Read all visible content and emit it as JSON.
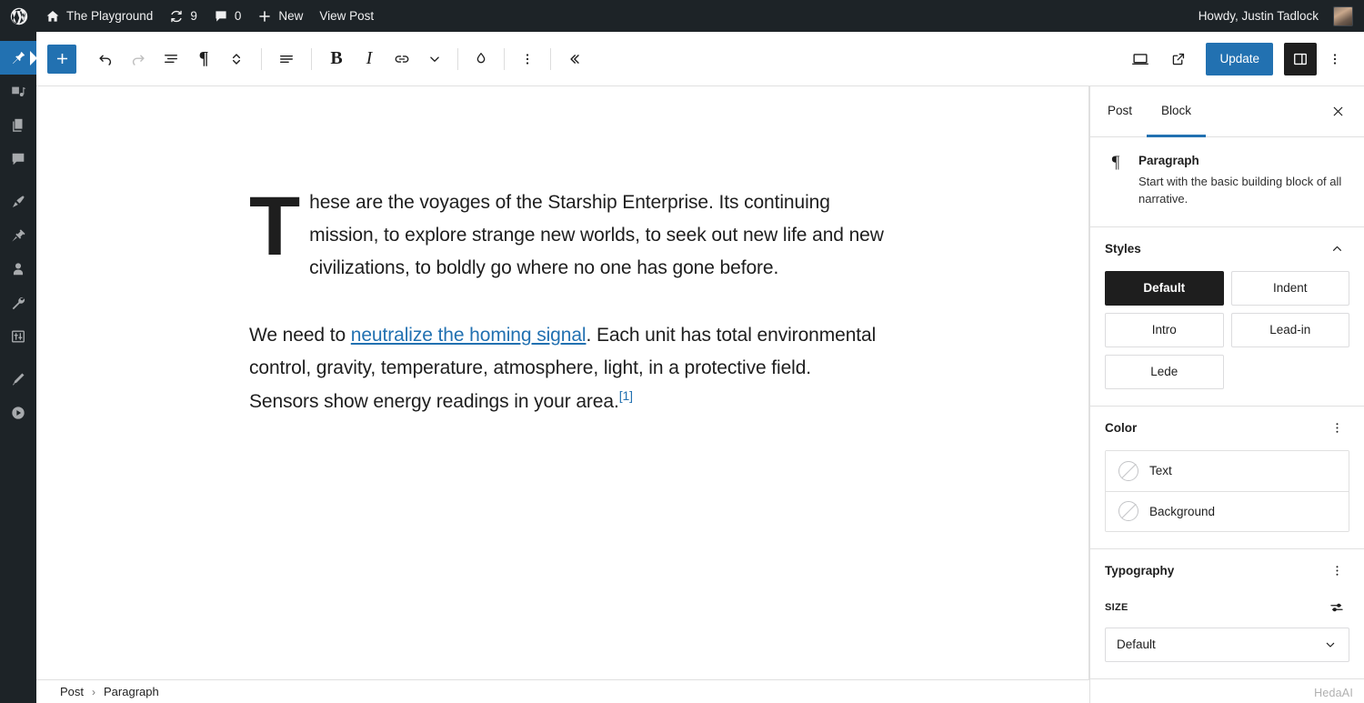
{
  "admin_bar": {
    "logo_icon": "wordpress-logo-icon",
    "site": {
      "label": "The Playground",
      "icon": "home-icon"
    },
    "updates": {
      "count": "9",
      "icon": "updates-icon"
    },
    "comments": {
      "count": "0",
      "icon": "comment-bubble-icon"
    },
    "new": {
      "label": "New",
      "icon": "plus-icon"
    },
    "view_post": {
      "label": "View Post"
    },
    "account": {
      "greeting": "Howdy, Justin Tadlock",
      "avatar": "user-avatar"
    }
  },
  "admin_menu": {
    "items": [
      {
        "name": "posts",
        "icon": "pin-icon",
        "current": true
      },
      {
        "name": "media",
        "icon": "media-icon",
        "current": false
      },
      {
        "name": "pages",
        "icon": "pages-icon",
        "current": false
      },
      {
        "name": "comments",
        "icon": "comment-icon",
        "current": false
      },
      {
        "name": "appearance",
        "icon": "paintbrush-icon",
        "current": false
      },
      {
        "name": "plugins",
        "icon": "plug-icon",
        "current": false
      },
      {
        "name": "users",
        "icon": "user-icon",
        "current": false
      },
      {
        "name": "tools",
        "icon": "wrench-icon",
        "current": false
      },
      {
        "name": "settings",
        "icon": "settings-sliders-icon",
        "current": false
      },
      {
        "name": "editor",
        "icon": "pencil-icon",
        "current": false
      },
      {
        "name": "player",
        "icon": "play-circle-icon",
        "current": false
      }
    ]
  },
  "toolbar": {
    "inserter": {
      "label": "Toggle block inserter",
      "icon": "plus-icon"
    },
    "undo": {
      "label": "Undo",
      "icon": "undo-arrow-icon"
    },
    "redo": {
      "label": "Redo",
      "icon": "redo-arrow-icon",
      "disabled": true
    },
    "list_view": {
      "label": "Document overview",
      "icon": "list-view-icon"
    },
    "block_type": {
      "label": "Paragraph",
      "icon": "pilcrow-icon",
      "glyph": "¶"
    },
    "move": {
      "label": "Move up or down",
      "icon": "chevron-up-down-icon"
    },
    "align": {
      "label": "Align text",
      "icon": "align-text-icon"
    },
    "bold": {
      "label": "Bold",
      "icon": "bold-icon",
      "glyph": "B"
    },
    "italic": {
      "label": "Italic",
      "icon": "italic-icon",
      "glyph": "I"
    },
    "link": {
      "label": "Link",
      "icon": "link-chain-icon"
    },
    "more_format": {
      "label": "More",
      "icon": "chevron-down-icon"
    },
    "highlight": {
      "label": "Highlight",
      "icon": "droplet-icon"
    },
    "options": {
      "label": "Options",
      "icon": "vertical-dots-icon"
    },
    "collapse": {
      "label": "Collapse toolbar",
      "icon": "double-chevron-left-icon"
    },
    "preview": {
      "label": "Preview",
      "icon": "desktop-icon"
    },
    "view": {
      "label": "View post",
      "icon": "external-link-icon"
    },
    "update_label": "Update",
    "settings_toggle": {
      "label": "Settings",
      "icon": "sidebar-panel-icon",
      "active": true
    },
    "more_menu": {
      "label": "Options",
      "icon": "vertical-dots-icon"
    }
  },
  "editor": {
    "paragraphs": [
      {
        "id": "p1",
        "dropcap": true,
        "text": "These are the voyages of the Starship Enterprise. Its continuing mission, to explore strange new worlds, to seek out new life and new civilizations, to boldly go where no one has gone before."
      }
    ],
    "paragraph2": {
      "before_link": "We need to ",
      "link_text": "neutralize the homing signal",
      "after_link": ". Each unit has total environmental control, gravity, temperature, atmosphere, light, in a protective field. Sensors show energy readings in your area.",
      "footnote": "[1]"
    }
  },
  "breadcrumb": {
    "items": [
      "Post",
      "Paragraph"
    ],
    "separator": "›"
  },
  "sidebar": {
    "tabs": [
      {
        "label": "Post",
        "active": false
      },
      {
        "label": "Block",
        "active": true
      }
    ],
    "close_icon": "close-x-icon",
    "block_card": {
      "icon": "pilcrow-icon",
      "glyph": "¶",
      "title": "Paragraph",
      "description": "Start with the basic building block of all narrative."
    },
    "styles": {
      "title": "Styles",
      "collapse_icon": "chevron-up-icon",
      "options": [
        {
          "label": "Default",
          "selected": true
        },
        {
          "label": "Indent",
          "selected": false
        },
        {
          "label": "Intro",
          "selected": false
        },
        {
          "label": "Lead-in",
          "selected": false
        },
        {
          "label": "Lede",
          "selected": false
        }
      ]
    },
    "color": {
      "title": "Color",
      "menu_icon": "vertical-dots-icon",
      "rows": [
        {
          "label": "Text",
          "swatch": "no-color-icon"
        },
        {
          "label": "Background",
          "swatch": "no-color-icon"
        }
      ]
    },
    "typography": {
      "title": "Typography",
      "menu_icon": "vertical-dots-icon",
      "size_label": "SIZE",
      "size_tools_icon": "settings-sliders-icon",
      "size_value": "Default",
      "dropdown_icon": "chevron-down-icon"
    }
  },
  "watermark": "HedaAI",
  "colors": {
    "admin_bg": "#1d2327",
    "accent_blue": "#2271b1",
    "link_blue": "#2271b1",
    "dark_selected": "#1e1e1e",
    "border": "#e0e0e0"
  }
}
